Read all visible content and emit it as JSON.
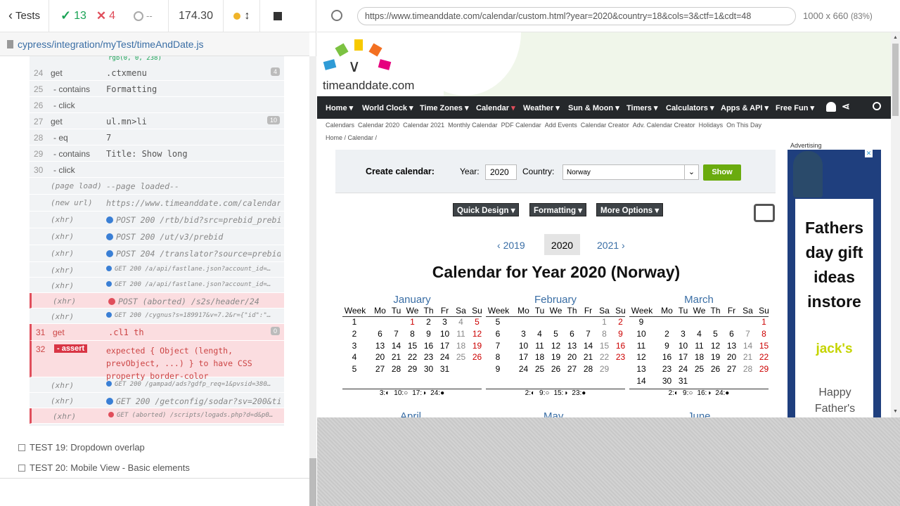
{
  "runner": {
    "tests_label": "Tests",
    "passed": "13",
    "failed": "4",
    "pending": "--",
    "duration": "174.30",
    "spec_path": "cypress/integration/myTest/timeAndDate.js",
    "rgb_text": "rgb(0, 0, 238)",
    "viewport_size": "1000 x 660",
    "viewport_scale": "(83%)"
  },
  "commands": [
    {
      "num": "24",
      "name": "get",
      "msg": ".ctxmenu",
      "badge": "4"
    },
    {
      "num": "25",
      "name": "- contains",
      "msg": "Formatting"
    },
    {
      "num": "26",
      "name": "- click",
      "msg": ""
    },
    {
      "num": "27",
      "name": "get",
      "msg": "ul.mn>li",
      "badge": "10"
    },
    {
      "num": "28",
      "name": "- eq",
      "msg": "7"
    },
    {
      "num": "29",
      "name": "- contains",
      "msg": "Title: Show long"
    },
    {
      "num": "30",
      "name": "- click",
      "msg": ""
    }
  ],
  "events": [
    {
      "name": "(page load)",
      "msg": "--page loaded--"
    },
    {
      "name": "(new url)",
      "msg": "https://www.timeanddate.com/calendar…"
    },
    {
      "name": "(xhr)",
      "msg": "POST 200 /rtb/bid?src=prebid_prebi…"
    },
    {
      "name": "(xhr)",
      "msg": "POST 200 /ut/v3/prebid"
    },
    {
      "name": "(xhr)",
      "msg": "POST 204 /translator?source=prebid…"
    },
    {
      "name": "(xhr)",
      "msg": "GET 200 /a/api/fastlane.json?account_id=…"
    },
    {
      "name": "(xhr)",
      "msg": "GET 200 /a/api/fastlane.json?account_id=…"
    },
    {
      "name": "(xhr)",
      "msg": "POST (aborted) /s2s/header/24"
    },
    {
      "name": "(xhr)",
      "msg": "GET 200 /cygnus?s=189917&v=7.2&r={\"id\":\"…"
    }
  ],
  "failed_get": {
    "num": "31",
    "name": "get",
    "msg": ".cl1 th",
    "badge": "0"
  },
  "assert": {
    "num": "32",
    "name": "- assert",
    "line1": "expected { Object (length,",
    "line2": "prevObject, ...) } to have CSS",
    "line3": "property border-color"
  },
  "events2": [
    {
      "name": "(xhr)",
      "msg": "GET 200 /gampad/ads?gdfp_req=1&pvsid=380…"
    },
    {
      "name": "(xhr)",
      "msg": "GET 200 /getconfig/sodar?sv=200&ti…"
    },
    {
      "name": "(xhr)",
      "msg": "GET (aborted) /scripts/logads.php?d=d&p0…"
    }
  ],
  "tests": [
    {
      "label": "TEST 19: Dropdown overlap"
    },
    {
      "label": "TEST 20: Mobile View - Basic elements"
    }
  ],
  "browser": {
    "url": "https://www.timeanddate.com/calendar/custom.html?year=2020&country=18&cols=3&ctf=1&cdt=48"
  },
  "site": {
    "logo": "timeanddate.com",
    "nav": [
      "Home",
      "World Clock",
      "Time Zones",
      "Calendar",
      "Weather",
      "Sun & Moon",
      "Timers",
      "Calculators",
      "Apps & API",
      "Free Fun"
    ],
    "subnav": [
      "Calendars",
      "Calendar 2020",
      "Calendar 2021",
      "Monthly Calendar",
      "PDF Calendar",
      "Add Events",
      "Calendar Creator",
      "Adv. Calendar Creator",
      "Holidays",
      "On This Day"
    ],
    "breadcrumb": "Home /   Calendar /",
    "create_label": "Create calendar:",
    "year_label": "Year:",
    "year_value": "2020",
    "country_label": "Country:",
    "country_value": "Norway",
    "show_button": "Show",
    "quick_design": "Quick Design",
    "formatting": "Formatting",
    "more_options": "More Options",
    "prev_year": "2019",
    "cur_year": "2020",
    "next_year": "2021",
    "title": "Calendar for Year 2020 (Norway)",
    "ad_label": "Advertising",
    "ad_headline": "Fathers day gift ideas instore",
    "ad_brand": "jack's",
    "ad_sub": "Happy Father's day",
    "next_months": [
      "April",
      "May",
      "June"
    ]
  },
  "calendar": {
    "headers": [
      "Week",
      "Mo",
      "Tu",
      "We",
      "Th",
      "Fr",
      "Sa",
      "Su"
    ],
    "months": [
      {
        "name": "January",
        "weeks": [
          [
            "1",
            "",
            "",
            "1",
            "2",
            "3",
            "4",
            "5"
          ],
          [
            "2",
            "6",
            "7",
            "8",
            "9",
            "10",
            "11",
            "12"
          ],
          [
            "3",
            "13",
            "14",
            "15",
            "16",
            "17",
            "18",
            "19"
          ],
          [
            "4",
            "20",
            "21",
            "22",
            "23",
            "24",
            "25",
            "26"
          ],
          [
            "5",
            "27",
            "28",
            "29",
            "30",
            "31",
            "",
            ""
          ]
        ],
        "holidays": [
          "1"
        ],
        "moons": [
          "3:◐",
          "10:○",
          "17:◑",
          "24:●"
        ]
      },
      {
        "name": "February",
        "weeks": [
          [
            "5",
            "",
            "",
            "",
            "",
            "",
            "1",
            "2"
          ],
          [
            "6",
            "3",
            "4",
            "5",
            "6",
            "7",
            "8",
            "9"
          ],
          [
            "7",
            "10",
            "11",
            "12",
            "13",
            "14",
            "15",
            "16"
          ],
          [
            "8",
            "17",
            "18",
            "19",
            "20",
            "21",
            "22",
            "23"
          ],
          [
            "9",
            "24",
            "25",
            "26",
            "27",
            "28",
            "29",
            ""
          ]
        ],
        "holidays": [],
        "moons": [
          "2:◐",
          "9:○",
          "15:◑",
          "23:●"
        ]
      },
      {
        "name": "March",
        "weeks": [
          [
            "9",
            "",
            "",
            "",
            "",
            "",
            "",
            "1"
          ],
          [
            "10",
            "2",
            "3",
            "4",
            "5",
            "6",
            "7",
            "8"
          ],
          [
            "11",
            "9",
            "10",
            "11",
            "12",
            "13",
            "14",
            "15"
          ],
          [
            "12",
            "16",
            "17",
            "18",
            "19",
            "20",
            "21",
            "22"
          ],
          [
            "13",
            "23",
            "24",
            "25",
            "26",
            "27",
            "28",
            "29"
          ],
          [
            "14",
            "30",
            "31",
            "",
            "",
            "",
            "",
            ""
          ]
        ],
        "holidays": [],
        "moons": [
          "2:◐",
          "9:○",
          "16:◑",
          "24:●"
        ]
      }
    ]
  },
  "colors": {
    "nav_bg": "#25282b",
    "show_btn": "#6aab0e",
    "link_blue": "#3a6ea5",
    "sunday_red": "#cc0000",
    "fail_red": "#e04e5b",
    "pass_green": "#1aa355"
  }
}
